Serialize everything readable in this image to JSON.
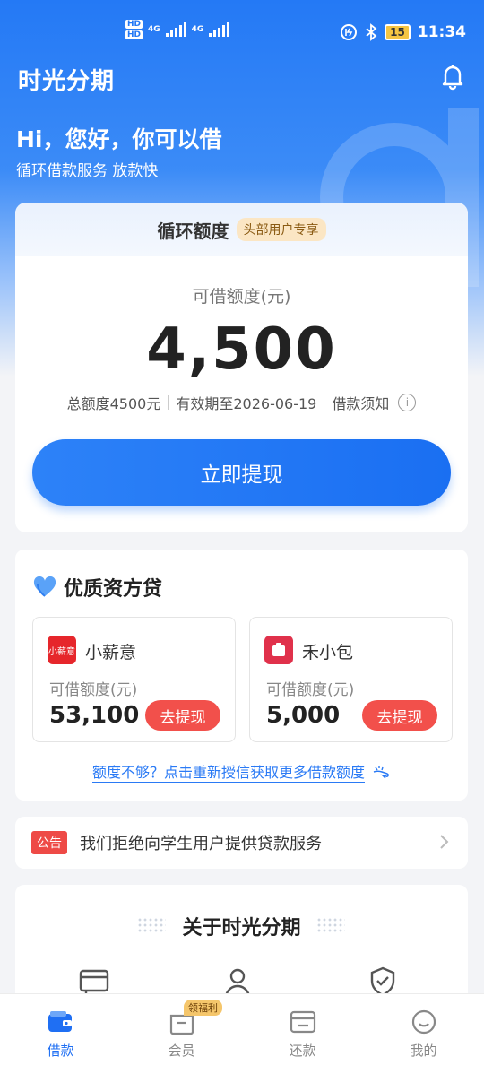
{
  "status_bar": {
    "hd1": "HD",
    "hd2": "HD",
    "net1": "4G",
    "net2": "4G",
    "battery": "15",
    "time": "11:34"
  },
  "header": {
    "app_title": "时光分期",
    "greeting": "Hi，您好，你可以借",
    "subtitle": "循环借款服务 放款快"
  },
  "credit": {
    "title": "循环额度",
    "badge": "头部用户专享",
    "available_label": "可借额度(元)",
    "amount": "4,500",
    "total": "总额度4500元",
    "valid_until": "有效期至2026-06-19",
    "notice": "借款须知",
    "info_glyph": "i",
    "withdraw_label": "立即提现"
  },
  "partners": {
    "title": "优质资方贷",
    "items": [
      {
        "name": "小薪意",
        "logo_text": "小薪意",
        "label": "可借额度(元)",
        "amount": "53,100",
        "button": "去提现",
        "logo_color": "#e6262b"
      },
      {
        "name": "禾小包",
        "logo_text": "",
        "label": "可借额度(元)",
        "amount": "5,000",
        "button": "去提现",
        "logo_color": "#e0314b"
      }
    ],
    "more_link": "额度不够？点击重新授信获取更多借款额度"
  },
  "notice": {
    "tag": "公告",
    "text": "我们拒绝向学生用户提供贷款服务"
  },
  "about": {
    "title": "关于时光分期"
  },
  "bottom_nav": {
    "items": [
      {
        "label": "借款",
        "icon": "wallet-icon"
      },
      {
        "label": "会员",
        "icon": "member-bag-icon"
      },
      {
        "label": "还款",
        "icon": "repay-card-icon"
      },
      {
        "label": "我的",
        "icon": "profile-face-icon"
      }
    ],
    "welfare_badge": "领福利"
  },
  "colors": {
    "primary": "#2479f5",
    "danger": "#f2504b",
    "accent_gold": "#fbe6c4"
  }
}
